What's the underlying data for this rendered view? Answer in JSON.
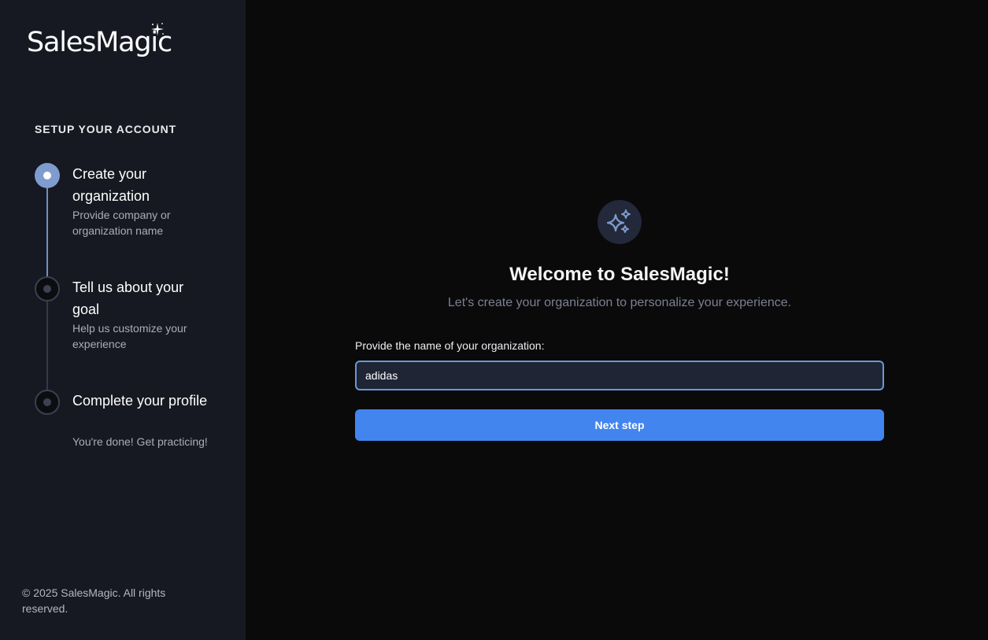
{
  "brand": {
    "name": "SalesMagic"
  },
  "sidebar": {
    "section_title": "SETUP YOUR ACCOUNT",
    "steps": [
      {
        "title": "Create your organization",
        "description": "Provide company or organization name",
        "status": "active"
      },
      {
        "title": "Tell us about your goal",
        "description": "Help us customize your experience",
        "status": "pending"
      },
      {
        "title": "Complete your profile",
        "description": "You're done! Get practicing!",
        "status": "pending"
      }
    ],
    "footer": "© 2025 SalesMagic. All rights reserved."
  },
  "main": {
    "icon": "sparkles-icon",
    "title": "Welcome to SalesMagic!",
    "subtitle": "Let's create your organization to personalize your experience.",
    "field_label": "Provide the name of your organization:",
    "org_name_value": "adidas",
    "next_button_label": "Next step"
  },
  "colors": {
    "accent": "#4285ee",
    "sidebar_bg": "#171922",
    "main_bg": "#0a0a0b",
    "active_step": "#7e9ccd"
  }
}
